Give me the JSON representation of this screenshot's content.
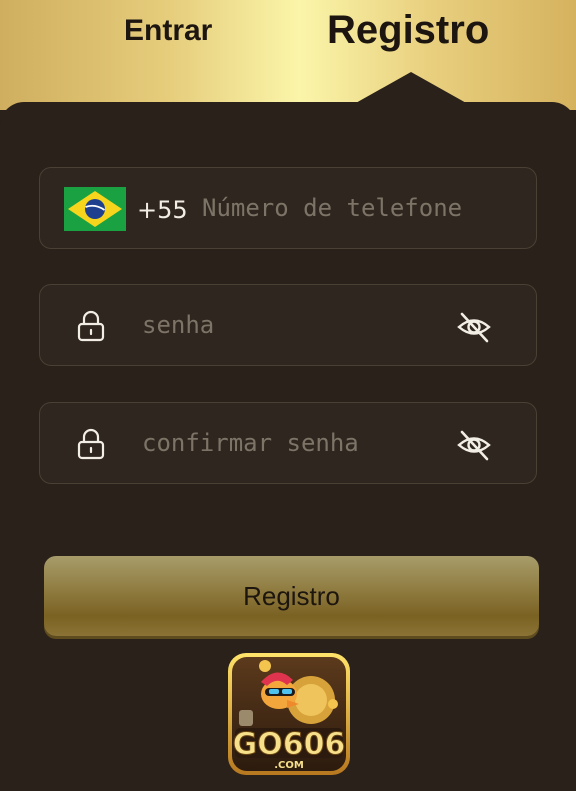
{
  "tabs": {
    "login_label": "Entrar",
    "register_label": "Registro"
  },
  "phone": {
    "country_code": "+55",
    "placeholder": "Número de telefone",
    "flag_icon": "brazil-flag-icon"
  },
  "password": {
    "placeholder": "senha",
    "lock_icon": "lock-icon",
    "toggle_icon": "eye-off-icon"
  },
  "confirm_password": {
    "placeholder": "confirmar senha",
    "lock_icon": "lock-icon",
    "toggle_icon": "eye-off-icon"
  },
  "submit": {
    "label": "Registro"
  },
  "logo": {
    "brand": "GO606",
    "domain": ".COM"
  },
  "colors": {
    "background": "#2a211a",
    "header_gold": "#fbf5a9",
    "button_gold": "#8e7a3e"
  }
}
